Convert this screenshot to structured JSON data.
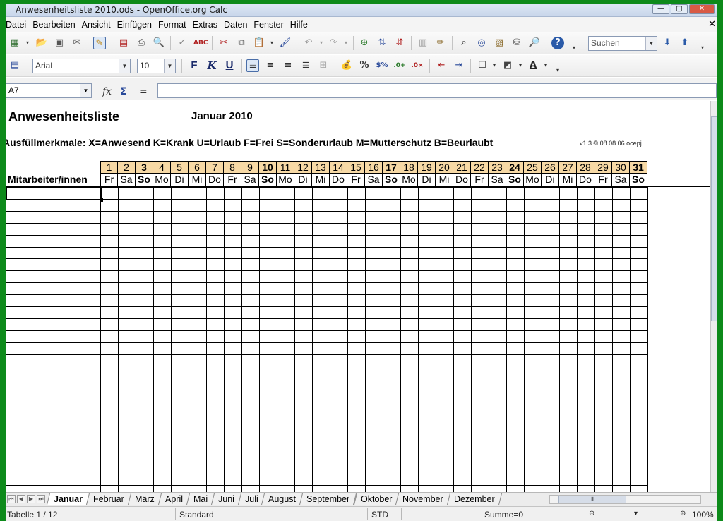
{
  "window": {
    "title": "Anwesenheitsliste 2010.ods - OpenOffice.org Calc",
    "minimize": "—",
    "maximize": "▢",
    "close": "✕"
  },
  "menu": [
    "Datei",
    "Bearbeiten",
    "Ansicht",
    "Einfügen",
    "Format",
    "Extras",
    "Daten",
    "Fenster",
    "Hilfe"
  ],
  "toolbar": {
    "search_placeholder": "Suchen",
    "font_name": "Arial",
    "font_size": "10",
    "bold_label": "F",
    "italic_label": "K",
    "underline_label": "U",
    "percent_label": "%"
  },
  "formula_bar": {
    "cell_ref": "A7",
    "fx_label": "fx",
    "sum_label": "Σ",
    "equals_label": "="
  },
  "sheet": {
    "title": "Anwesenheitsliste",
    "month": "Januar 2010",
    "legend": "Ausfüllmerkmale: X=Anwesend  K=Krank  U=Urlaub  F=Frei  S=Sonderurlaub  M=Mutterschutz  B=Beurlaubt",
    "version": "v1.3 © 08.08.06 ocepj",
    "name_header": "Mitarbeiter/innen",
    "day_numbers": [
      "1",
      "2",
      "3",
      "4",
      "5",
      "6",
      "7",
      "8",
      "9",
      "10",
      "11",
      "12",
      "13",
      "14",
      "15",
      "16",
      "17",
      "18",
      "19",
      "20",
      "21",
      "22",
      "23",
      "24",
      "25",
      "26",
      "27",
      "28",
      "29",
      "30",
      "31"
    ],
    "weekdays": [
      "Fr",
      "Sa",
      "So",
      "Mo",
      "Di",
      "Mi",
      "Do",
      "Fr",
      "Sa",
      "So",
      "Mo",
      "Di",
      "Mi",
      "Do",
      "Fr",
      "Sa",
      "So",
      "Mo",
      "Di",
      "Mi",
      "Do",
      "Fr",
      "Sa",
      "So",
      "Mo",
      "Di",
      "Mi",
      "Do",
      "Fr",
      "Sa",
      "So"
    ],
    "sundays": [
      3,
      10,
      17,
      24,
      31
    ],
    "header_color": "#f7d9a5"
  },
  "tabs": {
    "active": "Januar",
    "items": [
      "Januar",
      "Februar",
      "März",
      "April",
      "Mai",
      "Juni",
      "Juli",
      "August",
      "September",
      "Oktober",
      "November",
      "Dezember"
    ]
  },
  "status": {
    "sheet": "Tabelle 1 / 12",
    "style": "Standard",
    "mode": "STD",
    "sum": "Summe=0",
    "zoom": "100%"
  }
}
